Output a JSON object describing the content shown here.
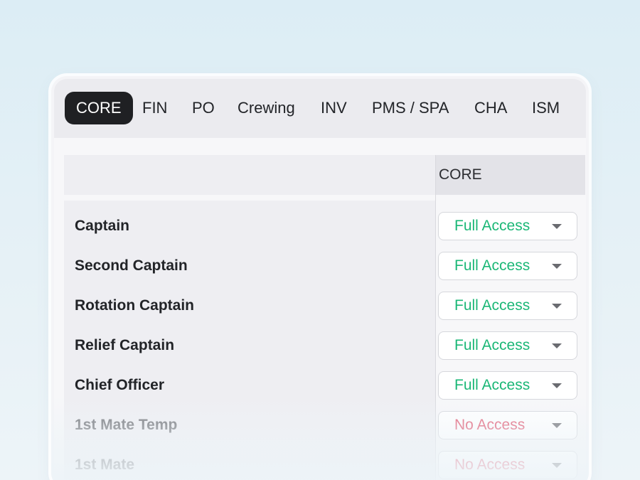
{
  "tabs": [
    {
      "label": "CORE",
      "active": true
    },
    {
      "label": "FIN"
    },
    {
      "label": "PO"
    },
    {
      "label": "Crewing"
    },
    {
      "label": "INV"
    },
    {
      "label": "PMS / SPA"
    },
    {
      "label": "CHA"
    },
    {
      "label": "ISM"
    }
  ],
  "table": {
    "column_header": "CORE",
    "rows": [
      {
        "role": "Captain",
        "access": "Full Access"
      },
      {
        "role": "Second Captain",
        "access": "Full Access"
      },
      {
        "role": "Rotation Captain",
        "access": "Full Access"
      },
      {
        "role": "Relief Captain",
        "access": "Full Access"
      },
      {
        "role": "Chief Officer",
        "access": "Full Access"
      },
      {
        "role": "1st Mate Temp",
        "access": "No Access"
      },
      {
        "role": "1st Mate",
        "access": "No Access"
      }
    ]
  },
  "colors": {
    "full_access": "#1ab776",
    "no_access": "#e1556e",
    "active_tab_bg": "#1f2023"
  },
  "icons": {
    "dropdown": "caret-down-icon"
  }
}
